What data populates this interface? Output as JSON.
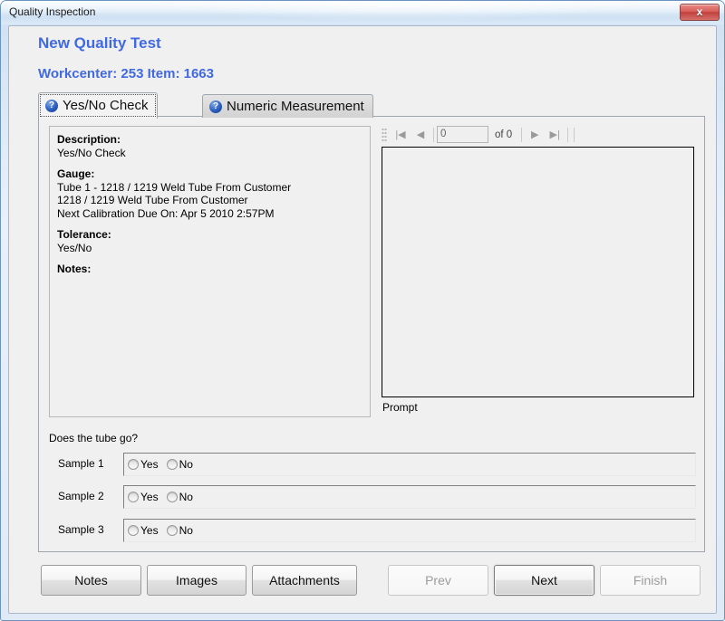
{
  "window": {
    "title": "Quality Inspection",
    "close_label": "x",
    "accent_color": "#4169e1",
    "close_color": "#c1403c"
  },
  "header": {
    "line1": "New Quality Test",
    "line2": "Workcenter: 253 Item: 1663"
  },
  "tabs": [
    {
      "label": "Yes/No Check",
      "icon": "help-icon",
      "icon_glyph": "?",
      "active": true
    },
    {
      "label": "Numeric Measurement",
      "icon": "help-icon",
      "icon_glyph": "?",
      "active": false
    }
  ],
  "description_panel": {
    "description_label": "Description:",
    "description_value": "Yes/No Check",
    "gauge_label": "Gauge:",
    "gauge_line1": "Tube 1 - 1218 / 1219 Weld Tube From Customer",
    "gauge_line2": "1218 / 1219 Weld Tube From Customer",
    "gauge_line3": "Next Calibration Due On: Apr 5 2010 2:57PM",
    "tolerance_label": "Tolerance:",
    "tolerance_value": "Yes/No",
    "notes_label": "Notes:"
  },
  "navigator": {
    "first_glyph": "|◀",
    "prev_glyph": "◀",
    "page_value": "0",
    "of_text": "of 0",
    "next_glyph": "▶",
    "last_glyph": "▶|"
  },
  "prompt": {
    "label": "Prompt"
  },
  "question": {
    "text": "Does the tube go?"
  },
  "samples": [
    {
      "label": "Sample 1",
      "yes_label": "Yes",
      "no_label": "No",
      "selected": ""
    },
    {
      "label": "Sample 2",
      "yes_label": "Yes",
      "no_label": "No",
      "selected": ""
    },
    {
      "label": "Sample 3",
      "yes_label": "Yes",
      "no_label": "No",
      "selected": ""
    }
  ],
  "buttons": {
    "notes": "Notes",
    "images": "Images",
    "attachments": "Attachments",
    "prev": "Prev",
    "next": "Next",
    "finish": "Finish"
  }
}
